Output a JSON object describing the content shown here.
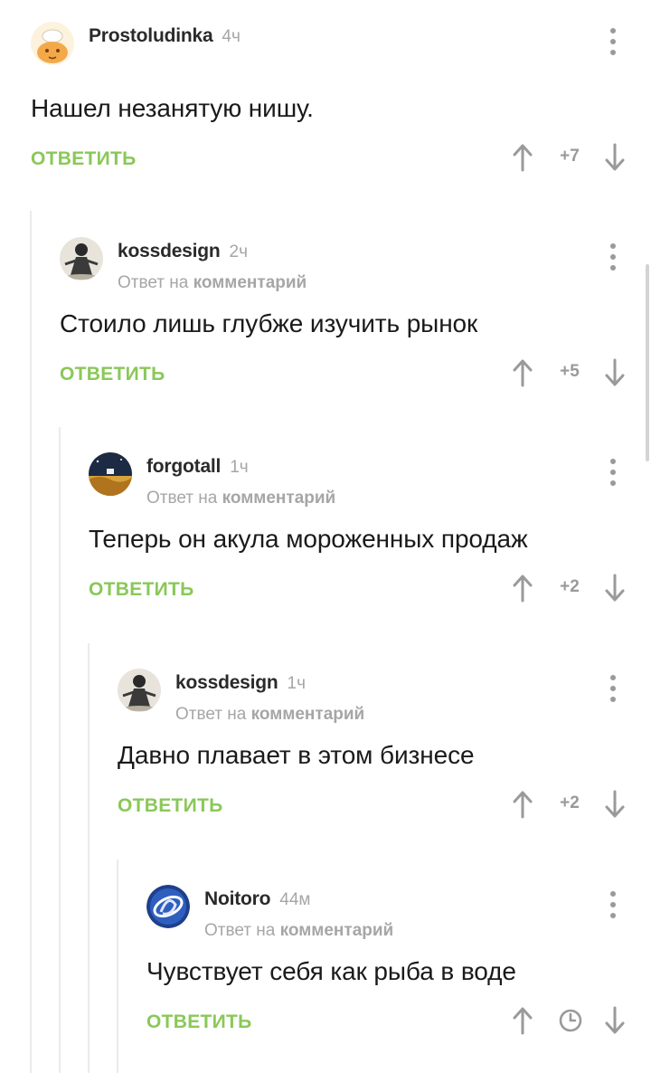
{
  "reply_to_label": "Ответ на",
  "reply_to_target": "комментарий",
  "reply_button_label": "ОТВЕТИТЬ",
  "colors": {
    "accent": "#8ac858",
    "muted": "#a6a6a6",
    "thread_line": "#ebebeb"
  },
  "comments": [
    {
      "author": "Prostoludinka",
      "time": "4ч",
      "text": "Нашел незанятую нишу.",
      "score": "+7",
      "is_reply": false,
      "avatar_icon": "cartoon-avatar"
    },
    {
      "author": "kossdesign",
      "time": "2ч",
      "text": "Стоило лишь глубже изучить рынок",
      "score": "+5",
      "is_reply": true,
      "avatar_icon": "figure-avatar"
    },
    {
      "author": "forgotall",
      "time": "1ч",
      "text": "Теперь он акула мороженных продаж",
      "score": "+2",
      "is_reply": true,
      "avatar_icon": "landscape-avatar"
    },
    {
      "author": "kossdesign",
      "time": "1ч",
      "text": "Давно плавает в этом бизнесе",
      "score": "+2",
      "is_reply": true,
      "avatar_icon": "figure-avatar"
    },
    {
      "author": "Noitoro",
      "time": "44м",
      "text": "Чувствует себя как рыба в воде",
      "score": "",
      "is_reply": true,
      "avatar_icon": "logo-avatar",
      "score_hidden_icon": "clock-icon"
    }
  ]
}
